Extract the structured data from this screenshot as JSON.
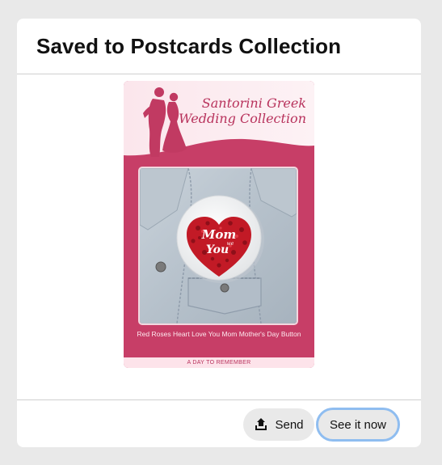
{
  "modal": {
    "title": "Saved to Postcards Collection"
  },
  "pin": {
    "brand_line_1": "Santorini Greek",
    "brand_line_2": "Wedding Collection",
    "badge_script_1": "Mom",
    "badge_script_2": "we",
    "badge_script_3": "You",
    "product_title": "Red Roses Heart Love You Mom Mother's Day Button",
    "footer_text": "A DAY TO REMEMBER",
    "colors": {
      "brand_pink": "#c73e67",
      "light_pink": "#fde3ea",
      "rose_red": "#c21a26"
    }
  },
  "footer": {
    "send_label": "Send",
    "send_icon": "upload-icon",
    "see_label": "See it now",
    "focus_ring_color": "#8fbdf0"
  }
}
